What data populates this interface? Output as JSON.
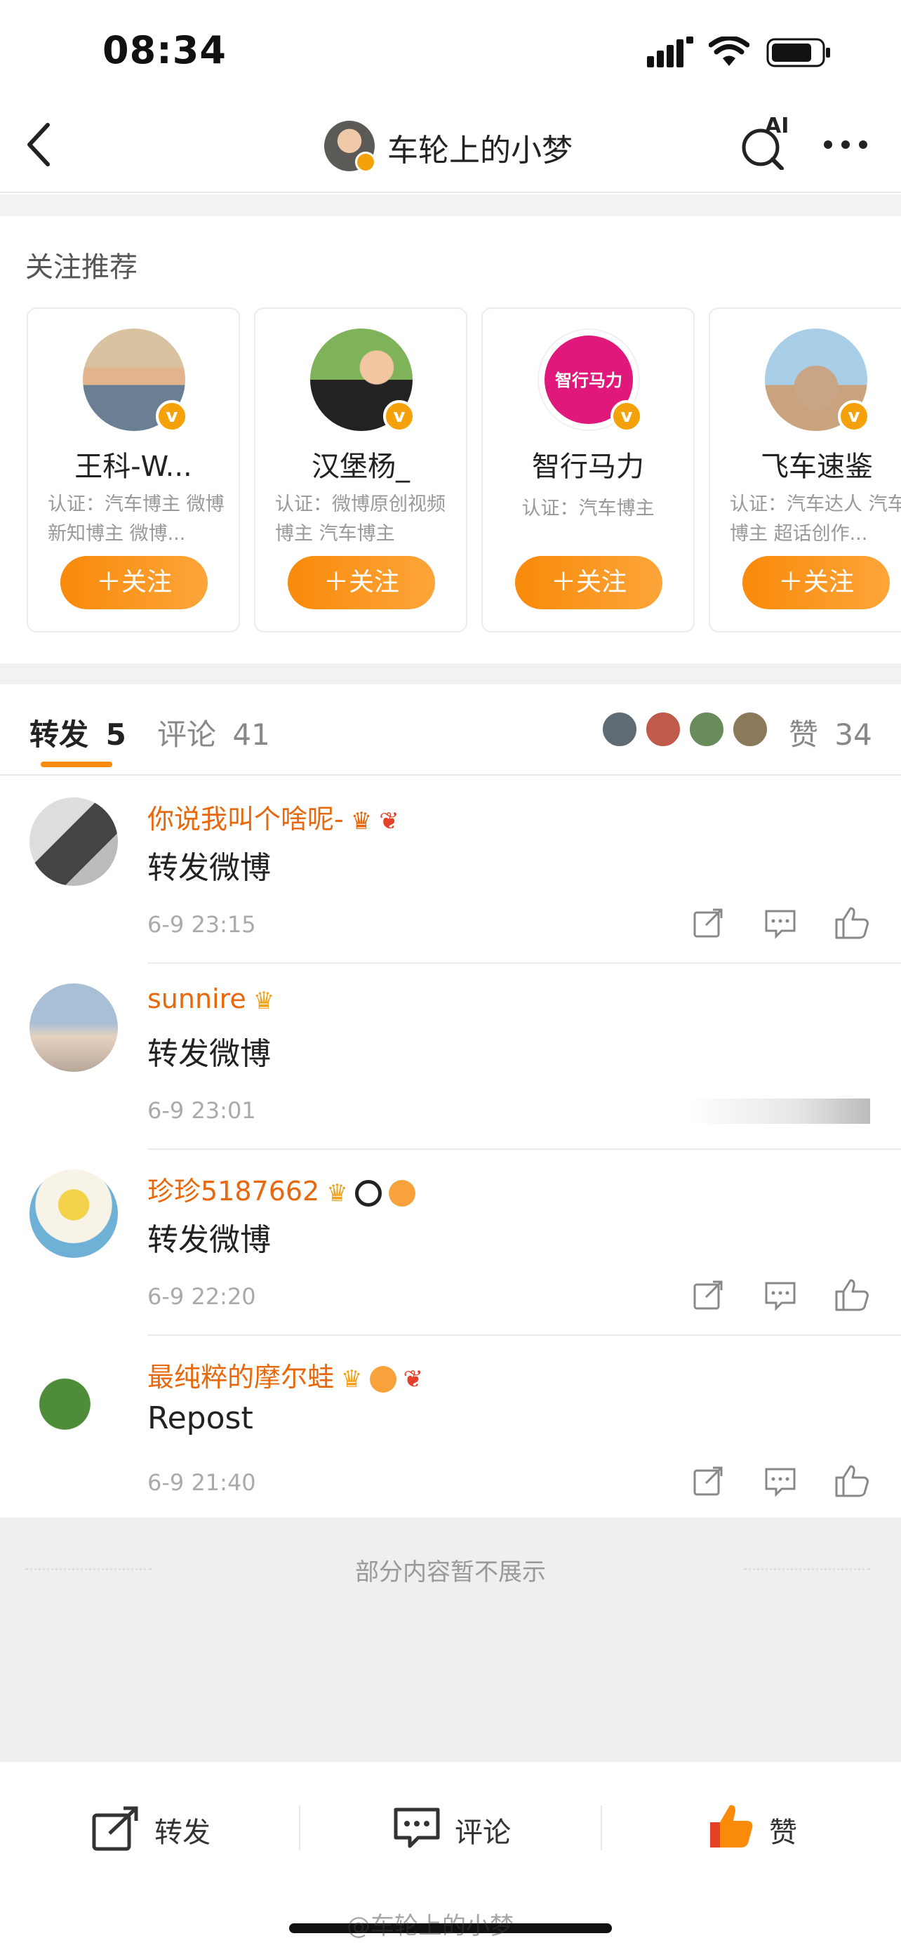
{
  "status": {
    "time": "08:34"
  },
  "nav": {
    "title": "车轮上的小梦",
    "ai_label": "AI"
  },
  "recommend": {
    "title": "关注推荐",
    "cards": [
      {
        "name": "王科-W...",
        "desc": "认证：汽车博主 微博新知博主 微博...",
        "follow": "＋关注"
      },
      {
        "name": "汉堡杨_",
        "desc": "认证：微博原创视频博主 汽车博主",
        "follow": "＋关注"
      },
      {
        "name": "智行马力",
        "desc": "认证：汽车博主",
        "follow": "＋关注",
        "logo_text": "智行马力"
      },
      {
        "name": "飞车速鉴",
        "desc": "认证：汽车达人 汽车博主 超话创作...",
        "follow": "＋关注"
      }
    ]
  },
  "tabs": {
    "repost": {
      "label": "转发",
      "count": "5"
    },
    "comment": {
      "label": "评论",
      "count": "41"
    },
    "like": {
      "label": "赞",
      "count": "34"
    }
  },
  "reposts": [
    {
      "user": "你说我叫个啥呢-",
      "text": "转发微博",
      "time": "6-9 23:15"
    },
    {
      "user": "sunnire",
      "text": "转发微博",
      "time": "6-9 23:01"
    },
    {
      "user": "珍珍5187662",
      "text": "转发微博",
      "time": "6-9 22:20"
    },
    {
      "user": "最纯粹的摩尔蛙",
      "text": "Repost",
      "time": "6-9 21:40"
    }
  ],
  "hidden_notice": "部分内容暂不展示",
  "bottom": {
    "repost": "转发",
    "comment": "评论",
    "like": "赞"
  },
  "watermark": "@车轮上的小梦",
  "colors": {
    "accent": "#f98a0a",
    "username": "#e8690d",
    "verified": "#f5a10a"
  }
}
